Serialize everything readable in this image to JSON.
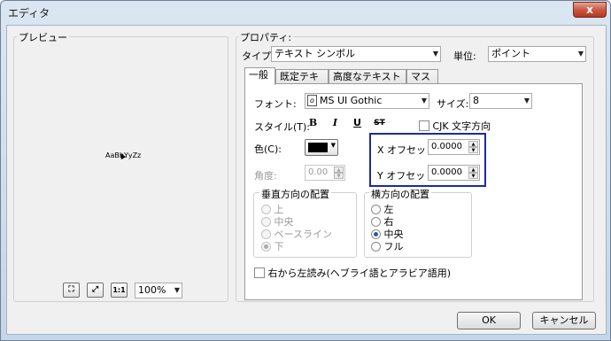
{
  "window": {
    "title": "エディタ",
    "close_glyph": "x"
  },
  "preview": {
    "label": "プレビュー",
    "sample_text": "AaBbYyZz",
    "zoom_value": "100%",
    "buttons": {
      "fit": "⛶",
      "full": "⤢",
      "actual": "1:1"
    }
  },
  "properties": {
    "label": "プロパティ:",
    "type_label": "タイプ:",
    "type_value": "テキスト シンボル",
    "unit_label": "単位:",
    "unit_value": "ポイント"
  },
  "tabs": [
    {
      "label": "一般"
    },
    {
      "label": "既定テキスト"
    },
    {
      "label": "高度なテキスト設定"
    },
    {
      "label": "マスク"
    }
  ],
  "general": {
    "font_label": "フォント:",
    "font_value": "MS UI Gothic",
    "size_label": "サイズ:",
    "size_value": "8",
    "style_label": "スタイル(T):",
    "style_buttons": {
      "bold": "B",
      "italic": "I",
      "underline": "U",
      "strike": "ST"
    },
    "cjk_label": "CJK 文字方向",
    "color_label": "色(C):",
    "color_value": "#000000",
    "x_offset_label": "X オフセット:",
    "x_offset_value": "0.0000",
    "y_offset_label": "Y オフセット:",
    "y_offset_value": "0.0000",
    "angle_label": "角度:",
    "angle_value": "0.00",
    "valign": {
      "label": "垂直方向の配置",
      "options": [
        "上",
        "中央",
        "ベースライン",
        "下"
      ],
      "selected": "下"
    },
    "halign": {
      "label": "横方向の配置",
      "options": [
        "左",
        "右",
        "中央",
        "フル"
      ],
      "selected": "中央"
    },
    "rtl_label": "右から左読み(ヘブライ語とアラビア語用)"
  },
  "footer": {
    "ok": "OK",
    "cancel": "キャンセル"
  },
  "colors": {
    "highlight_box": "#1a2aa8"
  }
}
